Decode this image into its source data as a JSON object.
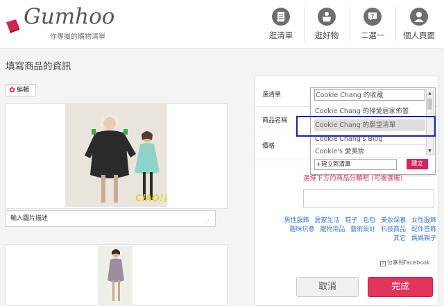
{
  "header": {
    "logo_text": "Gumhoo",
    "logo_tagline": "你專屬的購物清單",
    "nav": [
      {
        "label": "逛清單",
        "icon": "list-icon"
      },
      {
        "label": "逛好物",
        "icon": "box-icon"
      },
      {
        "label": "二選一",
        "icon": "question-icon"
      },
      {
        "label": "個人頁面",
        "icon": "person-icon"
      }
    ]
  },
  "left": {
    "page_title": "填寫商品的資訊",
    "edit_label": "編輯",
    "photo_caption": "CiAO!妞",
    "desc_placeholder": "輸入圖片描述"
  },
  "form": {
    "list_label": "選清單",
    "name_label": "商品名稱",
    "price_label": "價格",
    "dropdown": {
      "items": [
        "Cookie Chang 的收藏",
        "Cookie Chang 的掃愛居家佈置",
        "Cookie Chang 的願望清單",
        "Cookie Chang's Blog",
        "Cookie's 愛美妝"
      ],
      "selected_index": 2,
      "new_list_value": "+建立新清單",
      "create_label": "建立"
    },
    "category_hint": "選擇下方的商品分類吧 (可複選喔)",
    "categories_rows": [
      "男性服飾 居家生活 鞋子 包包 美妝保養 女性服飾",
      "趣味玩意 寵物用品 藝術設計 科技商品 配件首飾",
      "其它 媽媽親子"
    ],
    "share_label": "分享到Facebook",
    "share_checked": true,
    "cancel_label": "取消",
    "done_label": "完成"
  },
  "colors": {
    "accent": "#e2345d",
    "link": "#3d7bc4",
    "highlight": "#1323b8"
  }
}
